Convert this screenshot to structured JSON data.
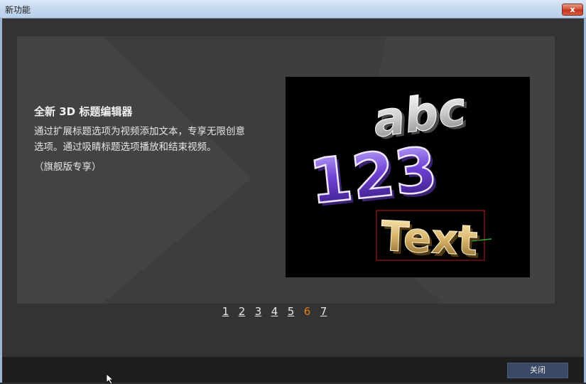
{
  "window": {
    "title": "新功能",
    "close_glyph": "x"
  },
  "feature": {
    "title": "全新  3D 标题编辑器",
    "description": "通过扩展标题选项为视频添加文本，专享无限创意选项。通过吸睛标题选项播放和结束视频。",
    "note": "（旗舰版专享）"
  },
  "preview": {
    "line1": "abc",
    "line2": "123",
    "line3": "Text"
  },
  "pager": {
    "pages": [
      "1",
      "2",
      "3",
      "4",
      "5",
      "6",
      "7"
    ],
    "active": "6"
  },
  "footer": {
    "close_label": "关闭"
  },
  "colors": {
    "accent": "#e07a1f",
    "button": "#3a4a66"
  }
}
